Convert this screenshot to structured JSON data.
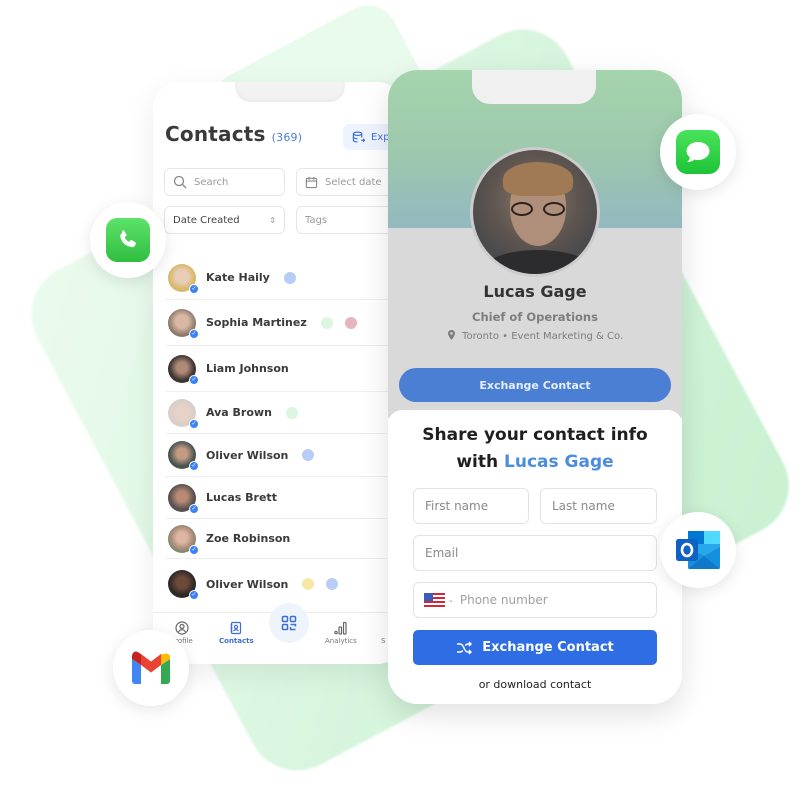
{
  "contacts_app": {
    "title": "Contacts",
    "count": "(369)",
    "export_label": "Exp",
    "search_placeholder": "Search",
    "date_placeholder": "Select date",
    "sort_value": "Date Created",
    "tags_placeholder": "Tags",
    "contacts": [
      {
        "name": "Kate Haily",
        "avatar_color": "#d8b96a",
        "tags": [
          "#b7cdf7"
        ]
      },
      {
        "name": "Sophia Martinez",
        "avatar_color": "#8a7868",
        "tags": [
          "#dcf5e0",
          "#e6b4bc"
        ]
      },
      {
        "name": "Liam Johnson",
        "avatar_color": "#3e3432",
        "tags": []
      },
      {
        "name": "Ava Brown",
        "avatar_color": "#d9cfc9",
        "tags": [
          "#dcf5e0"
        ]
      },
      {
        "name": "Oliver Wilson",
        "avatar_color": "#4a5552",
        "tags": [
          "#b7cdf7"
        ]
      },
      {
        "name": "Lucas Brett",
        "avatar_color": "#5a5050",
        "tags": []
      },
      {
        "name": "Zoe Robinson",
        "avatar_color": "#a88a78",
        "tags": []
      },
      {
        "name": "Oliver Wilson",
        "avatar_color": "#2e2826",
        "tags": [
          "#f7e7a6",
          "#b7cdf7"
        ]
      }
    ],
    "nav": {
      "profile": "Profile",
      "contacts": "Contacts",
      "analytics": "Analytics",
      "settings": "S"
    }
  },
  "profile_card": {
    "name": "Lucas Gage",
    "role": "Chief of Operations",
    "location": "Toronto • Event Marketing & Co.",
    "hero_button": "Exchange Contact",
    "share_title_line1": "Share your contact info",
    "share_title_prefix": "with",
    "share_title_name": "Lucas Gage",
    "first_name_placeholder": "First name",
    "last_name_placeholder": "Last name",
    "email_placeholder": "Email",
    "phone_placeholder": "Phone number",
    "exchange_button": "Exchange Contact",
    "download_link": "or download contact"
  },
  "integrations": [
    "Phone",
    "Messages",
    "Outlook",
    "Gmail"
  ],
  "colors": {
    "primary": "#2f6de5",
    "accent_link": "#4a8de0",
    "phone_green": "#34c759",
    "messages_green": "#28cd41",
    "outlook_blue": "#0f6cbd"
  }
}
